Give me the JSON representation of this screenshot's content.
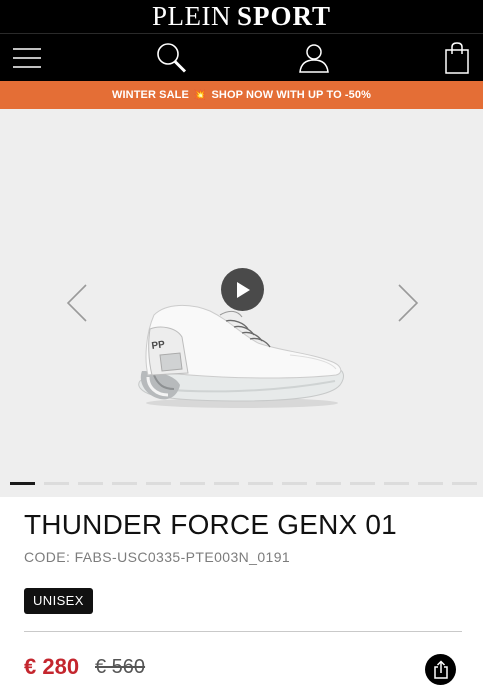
{
  "brand": {
    "logo_word1": "PLEIN",
    "logo_word2": "SPORT"
  },
  "nav": {
    "menu_icon": "hamburger-menu-icon",
    "search_icon": "search-icon",
    "account_icon": "user-icon",
    "bag_icon": "shopping-bag-icon"
  },
  "promo": {
    "text_before": "WINTER SALE",
    "burst_icon": "💥",
    "text_after": "SHOP NOW WITH UP TO -50%"
  },
  "gallery": {
    "prev_icon": "chevron-left-icon",
    "next_icon": "chevron-right-icon",
    "play_icon": "play-icon",
    "slide_count": 14,
    "active_slide": 1
  },
  "product": {
    "title": "THUNDER FORCE GENX 01",
    "code": "CODE: FABS-USC0335-PTE003N_0191",
    "badge": "UNISEX",
    "price": "€ 280",
    "old_price": "€ 560",
    "share_icon": "share-icon"
  },
  "colors": {
    "promo_bg": "#e46e36",
    "price": "#c4262e",
    "header_bg": "#000000",
    "gallery_bg": "#eeeeee"
  }
}
